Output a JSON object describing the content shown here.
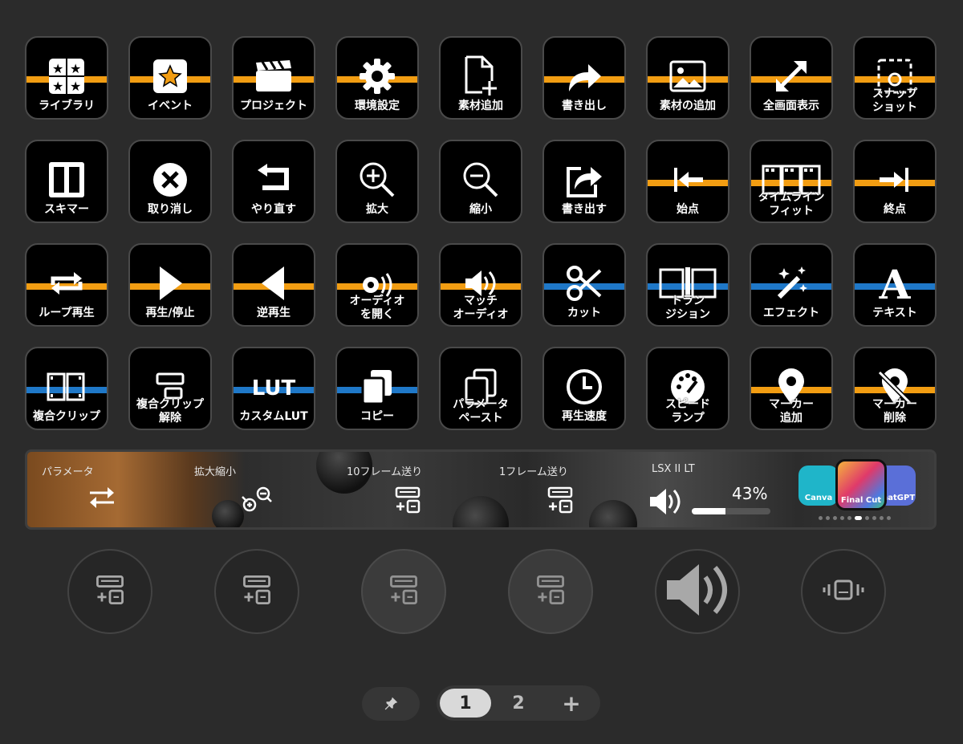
{
  "keys": [
    {
      "id": "key-library",
      "label": "ライブラリ",
      "stripe": "orange",
      "icon": "stars-grid-icon"
    },
    {
      "id": "key-event",
      "label": "イベント",
      "stripe": "orange",
      "icon": "star-box-icon"
    },
    {
      "id": "key-project",
      "label": "プロジェクト",
      "stripe": "orange",
      "icon": "clapperboard-icon"
    },
    {
      "id": "key-settings",
      "label": "環境設定",
      "stripe": "orange",
      "icon": "gear-icon"
    },
    {
      "id": "key-add-media",
      "label": "素材追加",
      "stripe": "none",
      "icon": "new-file-icon"
    },
    {
      "id": "key-export",
      "label": "書き出し",
      "stripe": "orange",
      "icon": "share-arrow-icon"
    },
    {
      "id": "key-add-media-2",
      "label": "素材の追加",
      "stripe": "orange",
      "icon": "image-icon"
    },
    {
      "id": "key-fullscreen",
      "label": "全画面表示",
      "stripe": "orange",
      "icon": "expand-arrows-icon"
    },
    {
      "id": "key-snapshot",
      "label": "スナップ\nショット",
      "stripe": "orange",
      "icon": "snapshot-icon"
    },
    {
      "id": "key-skimmer",
      "label": "スキマー",
      "stripe": "none",
      "icon": "skimmer-icon"
    },
    {
      "id": "key-undo",
      "label": "取り消し",
      "stripe": "none",
      "icon": "x-circle-icon"
    },
    {
      "id": "key-redo",
      "label": "やり直す",
      "stripe": "none",
      "icon": "return-icon"
    },
    {
      "id": "key-zoom-in",
      "label": "拡大",
      "stripe": "none",
      "icon": "zoom-in-icon"
    },
    {
      "id": "key-zoom-out",
      "label": "縮小",
      "stripe": "none",
      "icon": "zoom-out-icon"
    },
    {
      "id": "key-export-2",
      "label": "書き出す",
      "stripe": "none",
      "icon": "share-box-icon"
    },
    {
      "id": "key-start",
      "label": "始点",
      "stripe": "orange",
      "icon": "arrow-to-start-icon"
    },
    {
      "id": "key-timeline-fit",
      "label": "タイムライン\nフィット",
      "stripe": "orange",
      "icon": "film-strip-icon"
    },
    {
      "id": "key-end",
      "label": "終点",
      "stripe": "orange",
      "icon": "arrow-to-end-icon"
    },
    {
      "id": "key-loop",
      "label": "ループ再生",
      "stripe": "orange",
      "icon": "loop-icon"
    },
    {
      "id": "key-play",
      "label": "再生/停止",
      "stripe": "orange",
      "icon": "play-icon"
    },
    {
      "id": "key-reverse",
      "label": "逆再生",
      "stripe": "orange",
      "icon": "reverse-play-icon"
    },
    {
      "id": "key-open-audio",
      "label": "オーディオ\nを開く",
      "stripe": "orange",
      "icon": "audio-gear-icon"
    },
    {
      "id": "key-match-audio",
      "label": "マッチ\nオーディオ",
      "stripe": "orange",
      "icon": "speaker-icon"
    },
    {
      "id": "key-cut",
      "label": "カット",
      "stripe": "blue",
      "icon": "scissors-icon"
    },
    {
      "id": "key-transition",
      "label": "トラン\nジション",
      "stripe": "blue",
      "icon": "transition-icon"
    },
    {
      "id": "key-effect",
      "label": "エフェクト",
      "stripe": "blue",
      "icon": "magic-wand-icon"
    },
    {
      "id": "key-text",
      "label": "テキスト",
      "stripe": "blue",
      "icon": "letter-a-icon"
    },
    {
      "id": "key-compound-clip",
      "label": "複合クリップ",
      "stripe": "blue",
      "icon": "film-clip-icon"
    },
    {
      "id": "key-uncompound",
      "label": "複合クリップ\n解除",
      "stripe": "none",
      "icon": "uncompound-icon"
    },
    {
      "id": "key-custom-lut",
      "label": "カスタムLUT",
      "stripe": "blue",
      "icon": "lut-icon"
    },
    {
      "id": "key-copy",
      "label": "コピー",
      "stripe": "blue",
      "icon": "copy-icon"
    },
    {
      "id": "key-paste-params",
      "label": "パラメータ\nペースト",
      "stripe": "none",
      "icon": "paste-icon"
    },
    {
      "id": "key-speed",
      "label": "再生速度",
      "stripe": "none",
      "icon": "clock-icon"
    },
    {
      "id": "key-speed-ramp",
      "label": "スピード\nランプ",
      "stripe": "none",
      "icon": "gauge-icon"
    },
    {
      "id": "key-add-marker",
      "label": "マーカー\n追加",
      "stripe": "orange",
      "icon": "location-pin-icon"
    },
    {
      "id": "key-delete-marker",
      "label": "マーカー\n削除",
      "stripe": "orange",
      "icon": "pin-slash-icon"
    }
  ],
  "lcd": {
    "segments": [
      {
        "title": "パラメータ",
        "icon": "swap-arrows-icon"
      },
      {
        "title": "拡大縮小",
        "icon": "zoom-pair-icon"
      },
      {
        "title": "10フレーム送り",
        "icon": "frame-step-icon"
      },
      {
        "title": "1フレーム送り",
        "icon": "frame-step-icon"
      },
      {
        "title": "LSX II LT",
        "icon": "speaker-icon"
      }
    ],
    "volume_percent": "43%",
    "volume_level": 0.43,
    "apps": [
      {
        "name": "Canva",
        "color": "#1fb5c9"
      },
      {
        "name": "Final Cut",
        "color": "#e0503a"
      },
      {
        "name": "ChatGPT",
        "color": "#5a6fd8"
      }
    ],
    "page_dots": 10,
    "active_dot": 5
  },
  "dials": [
    {
      "id": "dial-1",
      "icon": "frame-step-icon",
      "dim": false
    },
    {
      "id": "dial-2",
      "icon": "frame-step-icon",
      "dim": false
    },
    {
      "id": "dial-3",
      "icon": "frame-step-icon",
      "dim": true
    },
    {
      "id": "dial-4",
      "icon": "frame-step-icon",
      "dim": true
    },
    {
      "id": "dial-5",
      "icon": "speaker-icon",
      "dim": false
    },
    {
      "id": "dial-6",
      "icon": "vibrate-icon",
      "dim": false
    }
  ],
  "pager": {
    "pages": [
      "1",
      "2"
    ],
    "active": "1",
    "add_label": "+"
  },
  "colors": {
    "orange": "#f29d12",
    "blue": "#1f78c8",
    "key_bg": "#000000",
    "panel_bg": "#2b2b2b"
  }
}
